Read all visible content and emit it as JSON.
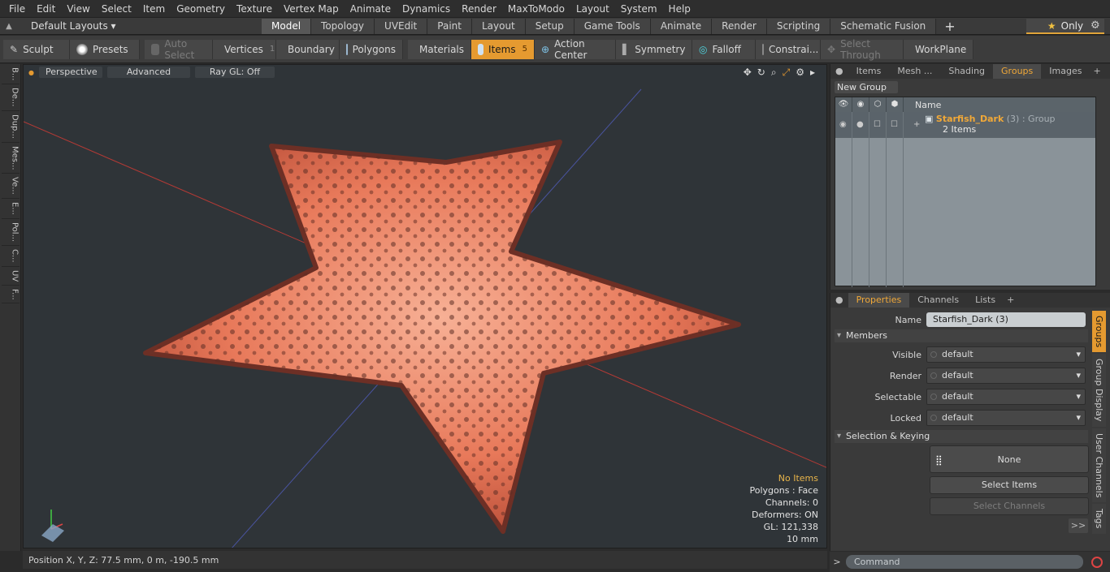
{
  "menu": [
    "File",
    "Edit",
    "View",
    "Select",
    "Item",
    "Geometry",
    "Texture",
    "Vertex Map",
    "Animate",
    "Dynamics",
    "Render",
    "MaxToModo",
    "Layout",
    "System",
    "Help"
  ],
  "layouts_label": "Default Layouts ▾",
  "tabs": [
    {
      "label": "Model",
      "active": true
    },
    {
      "label": "Topology"
    },
    {
      "label": "UVEdit"
    },
    {
      "label": "Paint"
    },
    {
      "label": "Layout"
    },
    {
      "label": "Setup"
    },
    {
      "label": "Game Tools"
    },
    {
      "label": "Animate"
    },
    {
      "label": "Render"
    },
    {
      "label": "Scripting"
    },
    {
      "label": "Schematic Fusion"
    }
  ],
  "only_label": "Only",
  "toolbar": {
    "sculpt": "Sculpt",
    "presets": "Presets",
    "auto_select": "Auto Select",
    "vertices": "Vertices",
    "vertices_count": "1",
    "boundary": "Boundary",
    "polygons": "Polygons",
    "materials": "Materials",
    "items": "Items",
    "items_count": "5",
    "action_center": "Action Center",
    "symmetry": "Symmetry",
    "falloff": "Falloff",
    "constraints": "Constrai...",
    "select_through": "Select Through",
    "workplane": "WorkPlane"
  },
  "leftstrip": [
    "B...",
    "De...",
    "Dup...",
    "Mes...",
    "Ve...",
    "E...",
    "Pol...",
    "C...",
    "UV",
    "F..."
  ],
  "viewport": {
    "perspective": "Perspective",
    "advanced": "Advanced",
    "raygl": "Ray GL: Off",
    "info": {
      "no_items": "No Items",
      "polygons": "Polygons : Face",
      "channels": "Channels: 0",
      "deformers": "Deformers: ON",
      "gl": "GL: 121,338",
      "scale": "10 mm"
    }
  },
  "status": {
    "position": "Position X, Y, Z:   77.5 mm, 0 m, -190.5 mm"
  },
  "right_top": {
    "tabs": [
      "Items",
      "Mesh ...",
      "Shading",
      "Groups",
      "Images"
    ],
    "new_group": "New Group",
    "col_name": "Name",
    "group": {
      "name": "Starfish_Dark",
      "count": "(3) : Group",
      "items": "2 Items"
    }
  },
  "properties": {
    "tabs": [
      "Properties",
      "Channels",
      "Lists"
    ],
    "name_label": "Name",
    "name_value": "Starfish_Dark (3)",
    "members_section": "Members",
    "fields": [
      {
        "label": "Visible",
        "value": "default"
      },
      {
        "label": "Render",
        "value": "default"
      },
      {
        "label": "Selectable",
        "value": "default"
      },
      {
        "label": "Locked",
        "value": "default"
      }
    ],
    "keying_section": "Selection & Keying",
    "none_label": "None",
    "select_items": "Select Items",
    "select_channels": "Select Channels",
    "more": ">>",
    "vtabs": [
      "Groups",
      "Group Display",
      "User Channels",
      "Tags"
    ]
  },
  "command_placeholder": "Command",
  "colors": {
    "accent": "#e59a30",
    "starfish": "#e8795a"
  }
}
